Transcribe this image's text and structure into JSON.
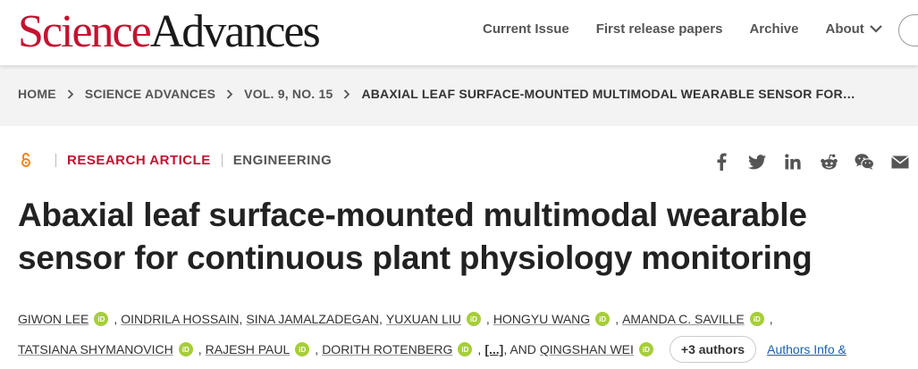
{
  "header": {
    "logo_science": "Science",
    "logo_advances": "Advances",
    "nav": [
      "Current Issue",
      "First release papers",
      "Archive",
      "About"
    ],
    "search_icon": "search-icon"
  },
  "breadcrumb": [
    "HOME",
    "SCIENCE ADVANCES",
    "VOL. 9, NO. 15",
    "ABAXIAL LEAF SURFACE-MOUNTED MULTIMODAL WEARABLE SENSOR FOR…"
  ],
  "article": {
    "access_icon": "open-access-icon",
    "type": "RESEARCH ARTICLE",
    "subject": "ENGINEERING",
    "title_line1": "Abaxial leaf surface-mounted multimodal wearable",
    "title_line2": "sensor for continuous plant physiology monitoring"
  },
  "share_icons": [
    "facebook-icon",
    "twitter-icon",
    "linkedin-icon",
    "reddit-icon",
    "wechat-icon",
    "email-icon"
  ],
  "authors": {
    "row1": [
      "GIWON LEE",
      "OINDRILA HOSSAIN",
      "SINA JAMALZADEGAN",
      "YUXUAN LIU",
      "HONGYU WANG",
      "AMANDA C. SAVILLE"
    ],
    "row2": [
      "TATSIANA SHYMANOVICH",
      "RAJESH PAUL",
      "DORITH ROTENBERG"
    ],
    "etal": "[...]",
    "and_text": ", AND",
    "last": "QINGSHAN WEI",
    "more_label": "+3 authors",
    "info_label": "Authors Info &",
    "orcid_label": "iD"
  },
  "colors": {
    "brand_red": "#c41230",
    "orcid_green": "#a6ce39",
    "link_blue": "#1a5fb4"
  }
}
